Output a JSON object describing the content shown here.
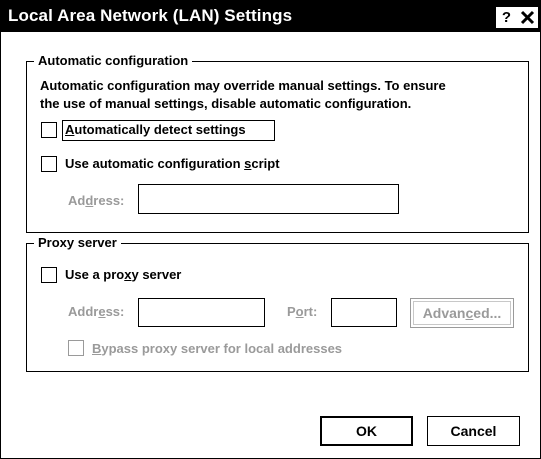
{
  "window": {
    "title": "Local Area Network (LAN) Settings",
    "help_label": "?"
  },
  "auto_config": {
    "legend": "Automatic configuration",
    "description_line1": "Automatic configuration may override manual settings. To ensure",
    "description_line2": "the use of manual settings, disable automatic configuration.",
    "detect_settings": {
      "pre": "",
      "key": "A",
      "post": "utomatically detect settings",
      "checked": false
    },
    "use_script": {
      "pre": "Use automatic configuration ",
      "key": "s",
      "post": "cript",
      "checked": false
    },
    "address": {
      "pre": "Ad",
      "key": "d",
      "post": "ress:",
      "value": "",
      "enabled": false
    }
  },
  "proxy": {
    "legend": "Proxy server",
    "use_proxy": {
      "pre": "Use a pro",
      "key": "x",
      "post": "y server",
      "checked": false
    },
    "address": {
      "pre": "Addr",
      "key": "e",
      "post": "ss:",
      "value": "",
      "enabled": false
    },
    "port": {
      "pre": "P",
      "key": "o",
      "post": "rt:",
      "value": "",
      "enabled": false
    },
    "advanced": {
      "pre": "Advan",
      "key": "c",
      "post": "ed...",
      "enabled": false
    },
    "bypass": {
      "pre": "",
      "key": "B",
      "post": "ypass proxy server for local addresses",
      "checked": false,
      "enabled": false
    }
  },
  "buttons": {
    "ok": "OK",
    "cancel": "Cancel"
  }
}
